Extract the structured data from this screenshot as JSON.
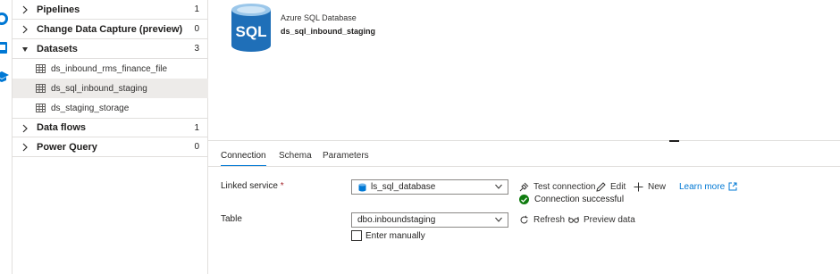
{
  "rail": {
    "icons": [
      "help-icon",
      "tool-icon",
      "graduation-cap-icon"
    ]
  },
  "tree": {
    "pipelines": {
      "label": "Pipelines",
      "count": "1"
    },
    "cdc": {
      "label": "Change Data Capture (preview)",
      "count": "0"
    },
    "datasets": {
      "label": "Datasets",
      "count": "3",
      "items": [
        "ds_inbound_rms_finance_file",
        "ds_sql_inbound_staging",
        "ds_staging_storage"
      ]
    },
    "dataflows": {
      "label": "Data flows",
      "count": "1"
    },
    "powerquery": {
      "label": "Power Query",
      "count": "0"
    }
  },
  "dataset": {
    "logo_text": "SQL",
    "type": "Azure SQL Database",
    "name": "ds_sql_inbound_staging"
  },
  "tabs": {
    "connection": "Connection",
    "schema": "Schema",
    "parameters": "Parameters"
  },
  "form": {
    "linked_service": {
      "label": "Linked service",
      "required": "*",
      "value": "ls_sql_database",
      "test_connection": "Test connection",
      "edit": "Edit",
      "new": "New",
      "learn_more": "Learn more",
      "status": "Connection successful"
    },
    "table": {
      "label": "Table",
      "value": "dbo.inboundstaging",
      "refresh": "Refresh",
      "preview": "Preview data",
      "enter_manually": "Enter manually"
    }
  },
  "colors": {
    "accent": "#0078d4",
    "success": "#107c10",
    "selected_row": "#edebe9"
  }
}
